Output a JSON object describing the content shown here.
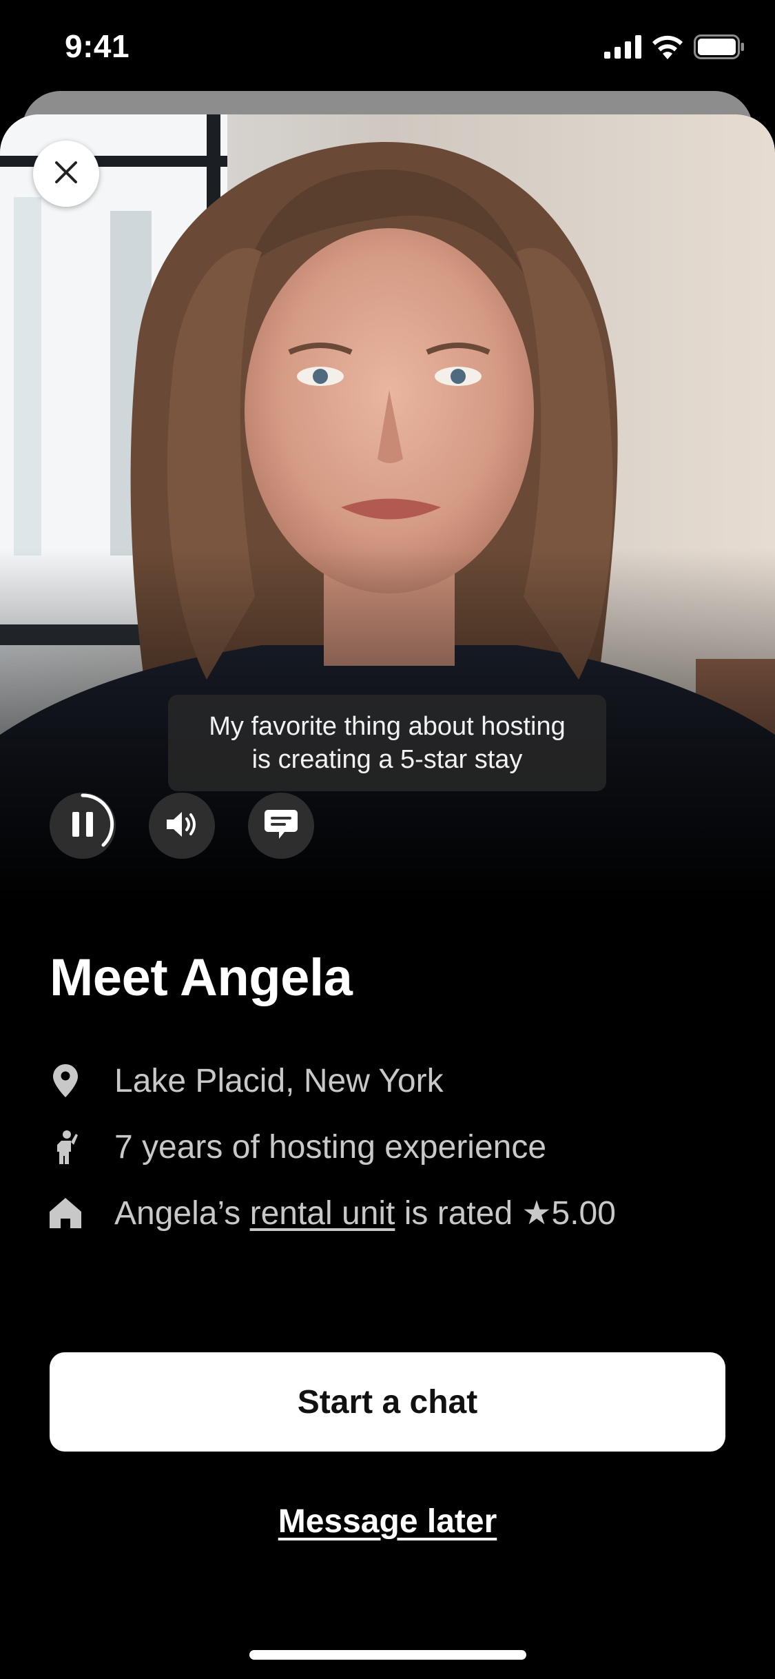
{
  "status_bar": {
    "time": "9:41",
    "icons": [
      "cellular-signal-icon",
      "wifi-icon",
      "battery-icon"
    ]
  },
  "video": {
    "caption_line1": "My favorite thing about hosting",
    "caption_line2": "is creating a 5-star stay",
    "controls": [
      "pause-icon",
      "volume-icon",
      "captions-icon"
    ],
    "close_icon": "close-icon"
  },
  "host": {
    "title": "Meet Angela",
    "location": "Lake Placid, New York",
    "experience": "7 years of hosting experience",
    "rating_prefix": "Angela’s ",
    "rating_link": "rental unit",
    "rating_suffix": " is rated ★5.00"
  },
  "actions": {
    "primary": "Start a chat",
    "secondary": "Message later"
  },
  "colors": {
    "background": "#000000",
    "primary_button": "#ffffff",
    "secondary_text": "#c8c8c8"
  }
}
